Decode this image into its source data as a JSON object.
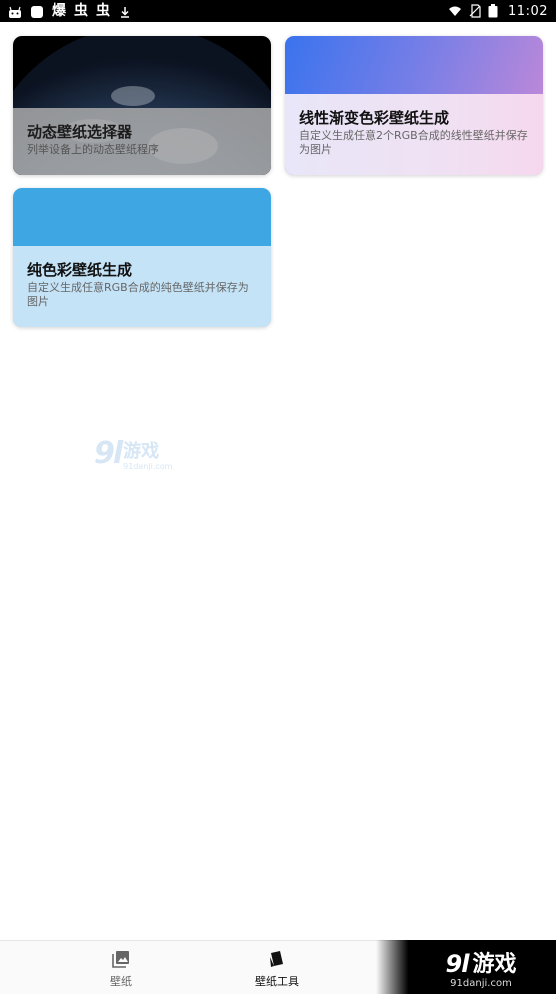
{
  "status_bar": {
    "left_glyphs": [
      "爆",
      "虫",
      "虫"
    ],
    "time": "11:02"
  },
  "cards": [
    {
      "title": "动态壁纸选择器",
      "desc": "列举设备上的动态壁纸程序"
    },
    {
      "title": "线性渐变色彩壁纸生成",
      "desc": "自定义生成任意2个RGB合成的线性壁纸并保存为图片"
    },
    {
      "title": "纯色彩壁纸生成",
      "desc": "自定义生成任意RGB合成的纯色壁纸并保存为图片"
    }
  ],
  "watermark": {
    "logo": "9l",
    "name": "游戏",
    "domain": "91danji.com"
  },
  "bottom_nav": {
    "items": [
      {
        "label": "壁纸",
        "icon": "image-gallery-icon"
      },
      {
        "label": "壁纸工具",
        "icon": "tools-icon"
      }
    ]
  },
  "corner_logo": {
    "logo": "9l",
    "name": "游戏",
    "domain": "91danji.com"
  },
  "colors": {
    "solid_card": "#3fa6e4",
    "gradient_start": "#3a73ee",
    "gradient_end": "#c98ad6"
  }
}
